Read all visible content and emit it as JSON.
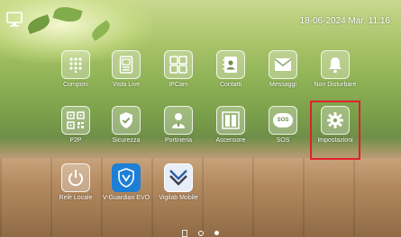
{
  "header": {
    "datetime": "18-06-2024 Mar. 11:16"
  },
  "apps": [
    {
      "label": "Componi"
    },
    {
      "label": "Vista Live"
    },
    {
      "label": "IPCam"
    },
    {
      "label": "Contatti"
    },
    {
      "label": "Messaggi"
    },
    {
      "label": "Non Disturbare"
    },
    {
      "label": "P2P"
    },
    {
      "label": "Sicurezza"
    },
    {
      "label": "Portineria"
    },
    {
      "label": "Ascensore"
    },
    {
      "label": "SOS",
      "icon_text": "SOS"
    },
    {
      "label": "Impostazioni",
      "highlighted": true
    },
    {
      "label": "Relè Locale"
    },
    {
      "label": "V-Guardian EVO"
    },
    {
      "label": "Vigilab Mobile"
    }
  ],
  "colors": {
    "highlight": "#e0202a",
    "vguardian_bg": "#1e7fd6",
    "vigilab_accent": "#2a5fa8"
  },
  "pager": {
    "pages": 2,
    "current_page": 2
  }
}
